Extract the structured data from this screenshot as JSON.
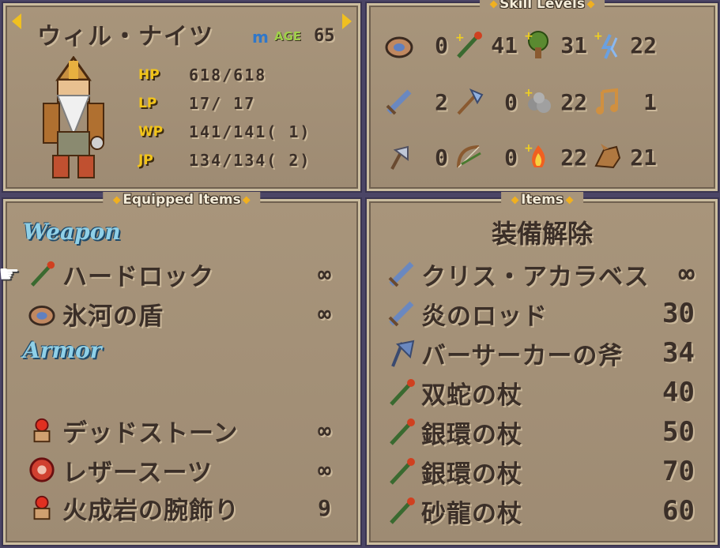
{
  "character": {
    "name": "ウィル・ナイツ",
    "gender_symbol": "m",
    "age_label": "AGE",
    "age": "65",
    "stats": [
      {
        "label": "HP",
        "value": "618/618"
      },
      {
        "label": "LP",
        "value": "17/ 17"
      },
      {
        "label": "WP",
        "value": "141/141( 1)"
      },
      {
        "label": "JP",
        "value": "134/134( 2)"
      }
    ]
  },
  "skills": {
    "title": "Skill Levels",
    "rows": [
      [
        {
          "icon": "shield-icon",
          "level": "0"
        },
        {
          "icon": "staff-icon",
          "level": "41"
        },
        {
          "icon": "tree-icon",
          "level": "31"
        },
        {
          "icon": "water-icon",
          "level": "22"
        }
      ],
      [
        {
          "icon": "sword-icon",
          "level": "2"
        },
        {
          "icon": "axe-icon",
          "level": "0"
        },
        {
          "icon": "rock-icon",
          "level": "22"
        },
        {
          "icon": "music-icon",
          "level": "1"
        }
      ],
      [
        {
          "icon": "hand-axe-icon",
          "level": "0"
        },
        {
          "icon": "bow-icon",
          "level": "0"
        },
        {
          "icon": "fire-icon",
          "level": "22"
        },
        {
          "icon": "beast-icon",
          "level": "21"
        }
      ]
    ]
  },
  "equipped": {
    "title": "Equipped Items",
    "weapon_header": "Weapon",
    "armor_header": "Armor",
    "weapons": [
      {
        "icon": "staff-icon",
        "name": "ハードロック",
        "qty": "∞"
      },
      {
        "icon": "shield-icon",
        "name": "氷河の盾",
        "qty": "∞"
      }
    ],
    "armors": [
      {
        "icon": "ring-icon",
        "name": "デッドストーン",
        "qty": "∞"
      },
      {
        "icon": "armor-icon",
        "name": "レザースーツ",
        "qty": "∞"
      },
      {
        "icon": "ring-icon",
        "name": "火成岩の腕飾り",
        "qty": "9"
      }
    ]
  },
  "items": {
    "title": "Items",
    "unequip": "装備解除",
    "list": [
      {
        "icon": "sword-icon",
        "name": "クリス・アカラベス",
        "qty": "∞"
      },
      {
        "icon": "sword-icon",
        "name": "炎のロッド",
        "qty": "30"
      },
      {
        "icon": "axe-icon",
        "name": "バーサーカーの斧",
        "qty": "34"
      },
      {
        "icon": "staff-icon",
        "name": "双蛇の杖",
        "qty": "40"
      },
      {
        "icon": "staff-icon",
        "name": "銀環の杖",
        "qty": "50"
      },
      {
        "icon": "staff-icon",
        "name": "銀環の杖",
        "qty": "70"
      },
      {
        "icon": "staff-icon",
        "name": "砂龍の杖",
        "qty": "60"
      }
    ]
  }
}
